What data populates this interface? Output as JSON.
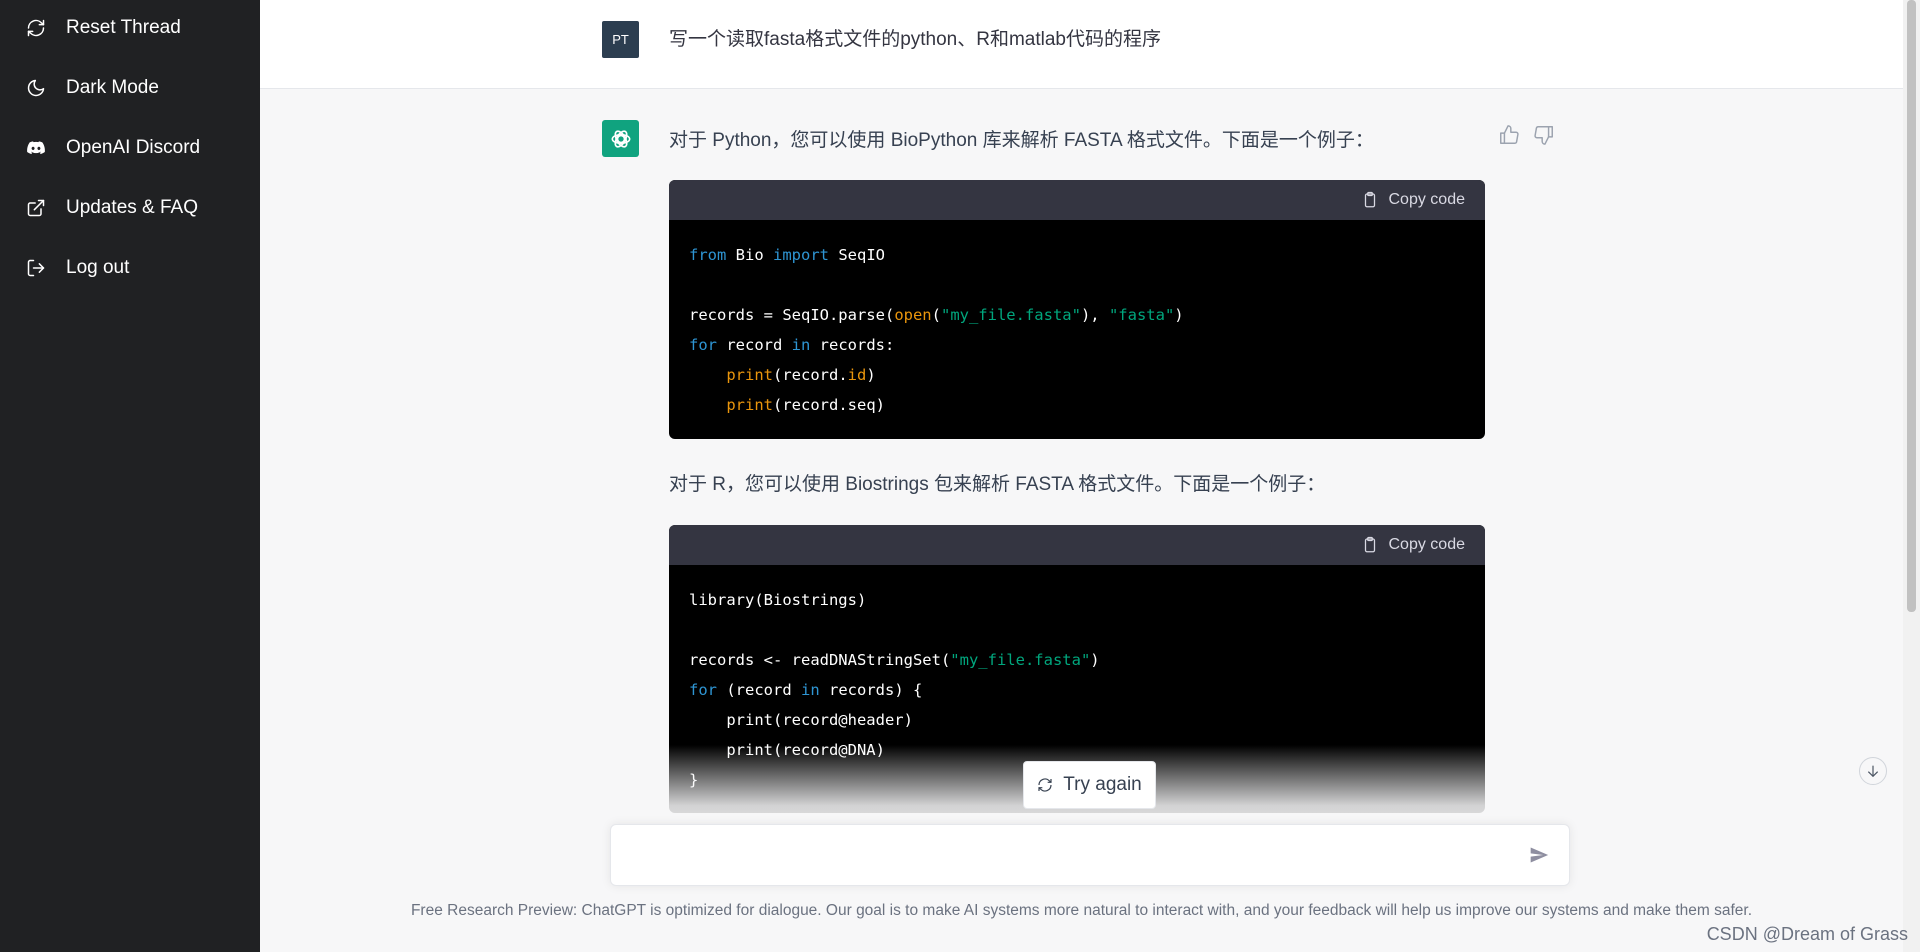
{
  "sidebar": {
    "items": [
      {
        "label": "Reset Thread",
        "icon": "refresh-icon"
      },
      {
        "label": "Dark Mode",
        "icon": "moon-icon"
      },
      {
        "label": "OpenAI Discord",
        "icon": "discord-icon"
      },
      {
        "label": "Updates & FAQ",
        "icon": "external-link-icon"
      },
      {
        "label": "Log out",
        "icon": "logout-icon"
      }
    ]
  },
  "user_message": {
    "avatar": "PT",
    "text": "写一个读取fasta格式文件的python、R和matlab代码的程序"
  },
  "bot_message": {
    "intro_python": "对于 Python，您可以使用 BioPython 库来解析 FASTA 格式文件。下面是一个例子：",
    "intro_r": "对于 R，您可以使用 Biostrings 包来解析 FASTA 格式文件。下面是一个例子：",
    "copy_label": "Copy code",
    "python_code": {
      "l1_kw1": "from",
      "l1_mid": " Bio ",
      "l1_kw2": "import",
      "l1_end": " SeqIO",
      "l3_a": "records = SeqIO.parse(",
      "l3_fn": "open",
      "l3_b": "(",
      "l3_s1": "\"my_file.fasta\"",
      "l3_c": "), ",
      "l3_s2": "\"fasta\"",
      "l3_d": ")",
      "l4_kw1": "for",
      "l4_mid": " record ",
      "l4_kw2": "in",
      "l4_end": " records:",
      "l5_indent": "    ",
      "l5_fn": "print",
      "l5_a": "(record.",
      "l5_attr": "id",
      "l5_b": ")",
      "l6_indent": "    ",
      "l6_fn": "print",
      "l6_a": "(record.seq)"
    },
    "r_code": {
      "l1": "library(Biostrings)",
      "l3_a": "records <- readDNAStringSet(",
      "l3_s": "\"my_file.fasta\"",
      "l3_b": ")",
      "l4_kw1": "for",
      "l4_mid": " (record ",
      "l4_kw2": "in",
      "l4_end": " records) {",
      "l5": "    print(record@header)",
      "l6": "    print(record@DNA)",
      "l7": "}"
    }
  },
  "try_again_label": "Try again",
  "input": {
    "placeholder": ""
  },
  "footer": "Free Research Preview: ChatGPT is optimized for dialogue. Our goal is to make AI systems more natural to interact with, and your feedback will help us improve our systems and make them safer.",
  "watermark": "CSDN @Dream of Grass",
  "colors": {
    "sidebar_bg": "#202123",
    "bot_avatar": "#10a37f",
    "user_avatar": "#2c3e50",
    "code_keyword": "#2e95d3",
    "code_string": "#00a67d",
    "code_builtin": "#e9950c"
  }
}
